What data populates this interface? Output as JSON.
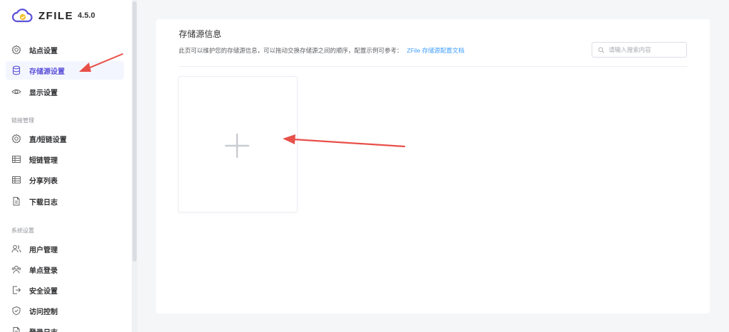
{
  "app": {
    "logo_text": "ZFILE",
    "version": "4.5.0"
  },
  "sidebar": {
    "items_top": [
      {
        "label": "站点设置",
        "icon": "gear-icon"
      },
      {
        "label": "存储源设置",
        "icon": "database-icon",
        "active": true
      },
      {
        "label": "显示设置",
        "icon": "eye-icon"
      }
    ],
    "group_link": "链接管理",
    "items_link": [
      {
        "label": "直/短链设置",
        "icon": "gear-icon"
      },
      {
        "label": "短链管理",
        "icon": "table-icon"
      },
      {
        "label": "分享列表",
        "icon": "table-icon"
      },
      {
        "label": "下载日志",
        "icon": "file-icon"
      }
    ],
    "group_system": "系统设置",
    "items_system": [
      {
        "label": "用户管理",
        "icon": "users-icon"
      },
      {
        "label": "单点登录",
        "icon": "user-group-icon"
      },
      {
        "label": "安全设置",
        "icon": "logout-icon"
      },
      {
        "label": "访问控制",
        "icon": "shield-icon"
      },
      {
        "label": "登录日志",
        "icon": "file-icon"
      }
    ]
  },
  "main": {
    "title": "存储源信息",
    "description": "此页可以维护您的存储源信息，可以拖动交换存储源之间的顺序，配置示例可参考：",
    "doc_link": "ZFile 存储源配置文档",
    "search_placeholder": "请输入搜索内容",
    "add_card_icon": "plus-icon"
  },
  "colors": {
    "accent": "#5b51d8",
    "active_bg": "#f4f6ff",
    "link": "#409eff",
    "annotation_arrow": "#e8504a",
    "logo_yellow": "#f2c12e"
  }
}
